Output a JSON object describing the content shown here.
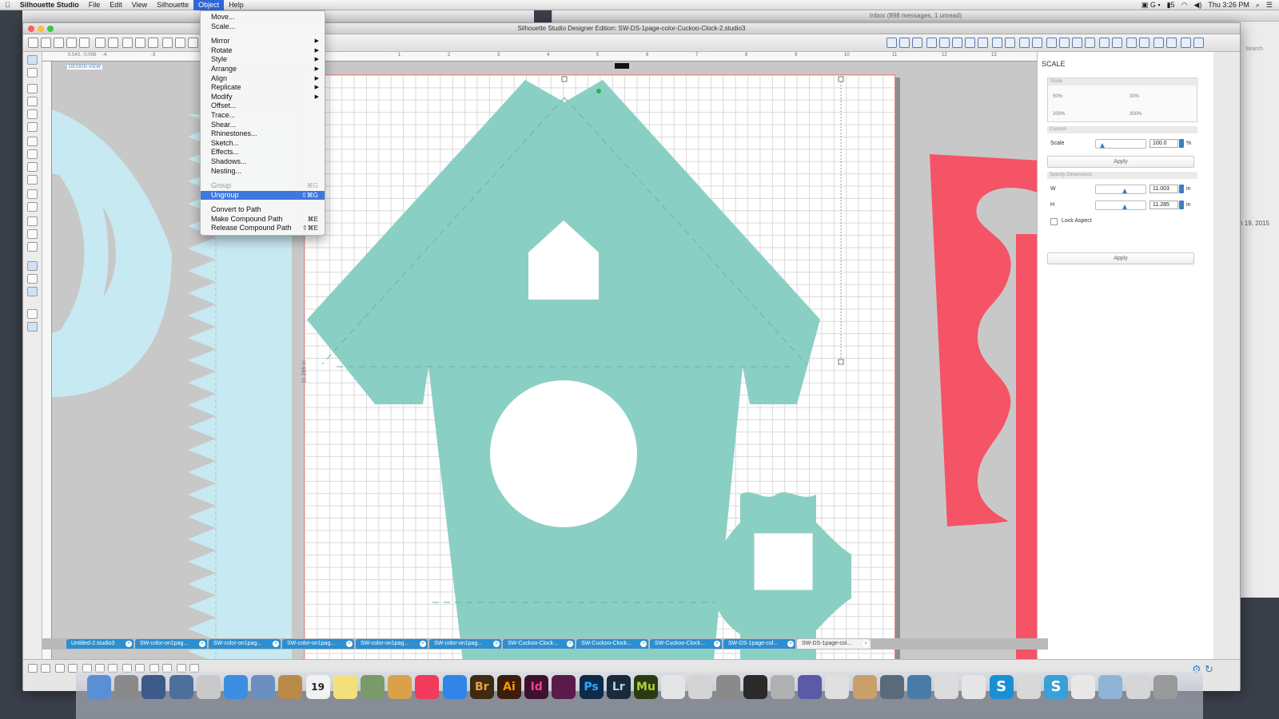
{
  "menubar": {
    "apple": "",
    "app": "Silhouette Studio",
    "items": [
      "File",
      "Edit",
      "View",
      "Silhouette",
      "Object",
      "Help"
    ],
    "active": "Object",
    "clock": "Thu 3:26 PM",
    "battery": "5"
  },
  "mail": {
    "title": "Inbox (898 messages, 1 unread)",
    "date_fragment": "h 19, 2015",
    "search_placeholder": "Search"
  },
  "window": {
    "title": "Silhouette Studio Designer Edition: SW-DS-1page-color-Cuckoo-Clock-2.studio3"
  },
  "canvas": {
    "coord_readout": "0.543, -0.008",
    "design_view_label": "DESIGN VIEW",
    "height_dimension": "11.285 in",
    "ruler_ticks": [
      "-4",
      "-3",
      "1",
      "2",
      "3",
      "4",
      "5",
      "6",
      "7",
      "8",
      "9",
      "10",
      "11",
      "12",
      "13"
    ]
  },
  "object_menu": {
    "group1": [
      {
        "label": "Move..."
      },
      {
        "label": "Scale..."
      }
    ],
    "group2": [
      {
        "label": "Mirror",
        "submenu": true
      },
      {
        "label": "Rotate",
        "submenu": true
      },
      {
        "label": "Style",
        "submenu": true
      },
      {
        "label": "Arrange",
        "submenu": true
      },
      {
        "label": "Align",
        "submenu": true
      },
      {
        "label": "Replicate",
        "submenu": true
      },
      {
        "label": "Modify",
        "submenu": true
      },
      {
        "label": "Offset..."
      },
      {
        "label": "Trace..."
      },
      {
        "label": "Shear..."
      },
      {
        "label": "Rhinestones..."
      },
      {
        "label": "Sketch..."
      },
      {
        "label": "Effects..."
      },
      {
        "label": "Shadows..."
      },
      {
        "label": "Nesting..."
      }
    ],
    "group3": [
      {
        "label": "Group",
        "shortcut": "⌘G",
        "disabled": true
      },
      {
        "label": "Ungroup",
        "shortcut": "⇧⌘G",
        "selected": true
      }
    ],
    "group4": [
      {
        "label": "Convert to Path"
      },
      {
        "label": "Make Compound Path",
        "shortcut": "⌘E"
      },
      {
        "label": "Release Compound Path",
        "shortcut": "⇧⌘E"
      }
    ]
  },
  "scale_panel": {
    "title": "SCALE",
    "scale_section": "Scale",
    "presets": [
      "50%",
      "33%",
      "200%",
      "300%"
    ],
    "custom_section": "Custom",
    "scale_label": "Scale",
    "scale_value": "100.0",
    "scale_unit": "%",
    "apply1": "Apply",
    "dimensions_section": "Specify Dimensions",
    "w_label": "W",
    "w_value": "11.003",
    "w_unit": "in",
    "h_label": "H",
    "h_value": "11.285",
    "h_unit": "in",
    "lock_aspect": "Lock Aspect",
    "lock_checked": false,
    "apply2": "Apply"
  },
  "doc_tabs": [
    "Untitled-2.studio3",
    "SW-color-on1pag...",
    "SW-color-on1pag...",
    "SW-color-on1pag...",
    "SW-color-on1pag...",
    "SW-color-on1pag...",
    "SW-Cuckoo-Clock...",
    "SW-Cuckoo-Clock...",
    "SW-Cuckoo-Clock...",
    "SW-DS-1page-col...",
    "SW-DS-1page-col..."
  ],
  "active_tab_index": 10,
  "dock": [
    "Finder",
    "Settings",
    "Time",
    "Rocket",
    "Preview",
    "Safari",
    "Mail",
    "Stamps",
    "Calendar",
    "Notes",
    "Photo",
    "Pencil",
    "iTunes",
    "App Store",
    "Br",
    "Ai",
    "Id",
    "InDesign",
    "Ps",
    "Lr",
    "Mu",
    "Acrobat",
    "Stickies",
    "Calc",
    "Monitor",
    "Script",
    "Cube",
    "X",
    "Box",
    "Camera",
    "Books",
    "Scissors",
    "Doc",
    "S",
    "Stuff",
    "S",
    "Disk",
    "Folder",
    "Doc",
    "Trash"
  ],
  "calendar_day": "19",
  "colors": {
    "mint": "#8acfc3",
    "light_blue": "#c7e9f1",
    "coral": "#f55366",
    "accent": "#2b8fd1"
  }
}
